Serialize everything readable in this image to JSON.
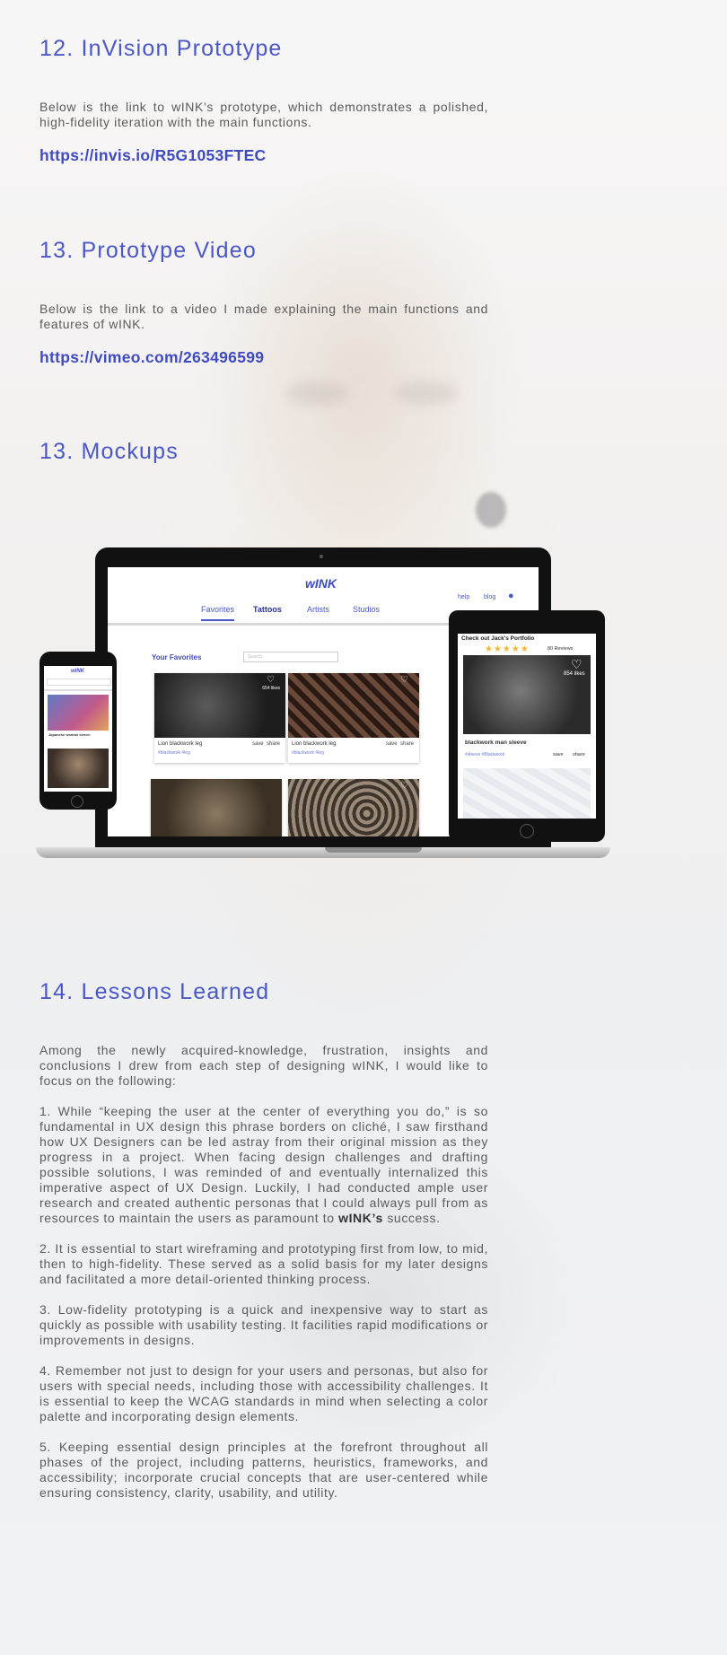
{
  "sections": {
    "invision": {
      "heading": "12. InVision Prototype",
      "text": "Below is the link to wINK’s prototype, which demonstrates a polished, high-fidelity iteration with the main functions.",
      "link": "https://invis.io/R5G1053FTEC"
    },
    "video": {
      "heading": "13. Prototype Video",
      "text": "Below is the link to a video I made explaining the main functions and features of wINK.",
      "link": "https://vimeo.com/263496599"
    },
    "mockups": {
      "heading": "13. Mockups"
    },
    "lessons": {
      "heading": "14. Lessons Learned",
      "intro": "Among the newly acquired-knowledge, frustration, insights and conclusions I drew from each step of designing wINK, I would like to focus on the following:",
      "item1_pre": "1. While “keeping the user at the center of everything you do,” is so fundamental in UX design this phrase borders on cliché, I saw firsthand how UX Designers can be led astray from their original mission as they progress in a project. When facing design challenges and drafting possible solutions, I was reminded of and eventually internalized this imperative aspect of UX Design. Luckily, I had conducted ample user research and created authentic personas that I could always pull from as resources to maintain the users as paramount to ",
      "item1_bold": "wINK’s",
      "item1_post": " success.",
      "item2": "2. It is essential to start wireframing and prototyping first from low, to mid, then to high-fidelity. These served as a solid basis for my later designs and facilitated a more detail-oriented thinking process.",
      "item3": "3. Low-fidelity prototyping is a quick and inexpensive way to start as quickly as possible with usability testing. It facilities rapid modifications or improvements in designs.",
      "item4": "4. Remember not just to design for your users and personas, but also for users with special needs, including those with accessibility challenges. It is essential to keep the WCAG standards in mind when selecting a color palette and incorporating design elements.",
      "item5": "5. Keeping essential design principles at the forefront throughout all phases of the project, including patterns, heuristics, frameworks, and accessibility; incorporate crucial concepts that are user-centered while ensuring consistency, clarity, usability, and utility."
    }
  },
  "mockup_screen": {
    "logo": "wINK",
    "nav": [
      "Favorites",
      "Tattoos",
      "Artists",
      "Studios"
    ],
    "help": "help",
    "blog": "blog",
    "your_favorites": "Your Favorites",
    "search_placeholder": "Search",
    "cards": [
      {
        "likes": "654 likes",
        "caption": "Lion blackwork leg",
        "tags": "#blackwork #leg",
        "save": "save",
        "share": "share"
      },
      {
        "likes": "",
        "caption": "Lion blackwork leg",
        "tags": "#blackwork #leg",
        "save": "save",
        "share": "share"
      }
    ]
  },
  "tablet_screen": {
    "title": "Check out Jack's Portfolio",
    "reviews": "80 Reviews",
    "likes": "854 likes",
    "caption": "blackwork man sleeve",
    "tags": "#sleeve #Blackwork",
    "save": "save",
    "share": "share"
  },
  "phone_screen": {
    "logo": "wINK",
    "caption": "Japanese woman sleeve"
  },
  "colors": {
    "accent": "#4a57c6",
    "link": "#3f4bc0",
    "body_text": "#5b5b5b"
  }
}
